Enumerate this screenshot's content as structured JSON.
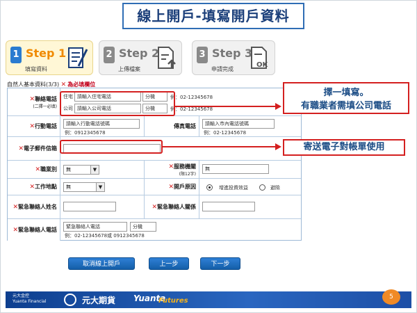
{
  "title": "線上開戶-填寫開戶資料",
  "steps": [
    {
      "num": "1",
      "title": "Step 1",
      "sub": "填寫資料",
      "icon": "form-pen-icon"
    },
    {
      "num": "2",
      "title": "Step 2",
      "sub": "上傳檔案",
      "icon": "upload-doc-icon"
    },
    {
      "num": "3",
      "title": "Step 3",
      "sub": "申請完成",
      "icon": "ok-doc-icon"
    }
  ],
  "section": {
    "label": "自然人基本資料(3/3)",
    "required_mark": "✕",
    "required_note": "為必填欄位"
  },
  "form": {
    "contact_phone": {
      "label": "聯絡電話",
      "note": "(二擇一必填)",
      "home_tag": "住宅",
      "home_placeholder": "請輸入住宅電話",
      "company_tag": "公司",
      "company_placeholder": "請輸入公司電話",
      "ext_label": "分機",
      "example_home": "例：02-12345678",
      "example_company": "例：02-12345678"
    },
    "mobile": {
      "label": "行動電話",
      "placeholder": "請輸入行動電話號碼",
      "example": "例：0912345678"
    },
    "fax": {
      "label": "傳真電話",
      "placeholder": "請輸入市內電話號碼",
      "example": "例：02-12345678"
    },
    "email": {
      "label": "電子郵件信箱",
      "value": ""
    },
    "occupation": {
      "label": "職業別",
      "value": "無"
    },
    "service_org": {
      "label": "服務機關",
      "note": "(限12字)",
      "value": "無"
    },
    "job_title": {
      "label": "工作地點",
      "value": "無"
    },
    "purpose": {
      "label": "開戶原因",
      "option1": "增進投資效益",
      "option2": "避險",
      "selected": "增進投資效益"
    },
    "emergency_name": {
      "label": "緊急聯絡人姓名",
      "value": ""
    },
    "emergency_relation": {
      "label": "緊急聯絡人關係",
      "value": ""
    },
    "emergency_phone": {
      "label": "緊急聯絡人電話",
      "placeholder": "緊急聯絡人電話",
      "ext_label": "分機",
      "example": "例：02-12345678或 0912345678"
    }
  },
  "callouts": {
    "phone_line1": "擇一填寫。",
    "phone_line2": "有職業者需填公司電話",
    "email": "寄送電子對帳單使用"
  },
  "buttons": {
    "cancel": "取消線上開戶",
    "prev": "上一步",
    "next": "下一步"
  },
  "footer": {
    "group_zh": "元大金控",
    "group_en": "Yuanta Financial",
    "brand": "元大期貨",
    "yuanta": "Yuanta",
    "futures": "Futures",
    "page": "5"
  },
  "colors": {
    "accent": "#2f6db5",
    "highlight": "#d42020",
    "step_active": "#f08a00",
    "button": "#1a6ec4"
  }
}
